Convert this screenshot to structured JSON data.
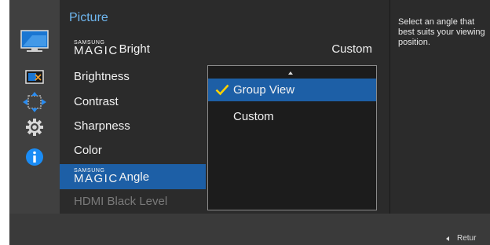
{
  "menu": {
    "title": "Picture",
    "magic_small": "SAMSUNG",
    "magic_big": "MAGIC",
    "items": [
      {
        "label": "Bright"
      },
      {
        "label": "Brightness"
      },
      {
        "label": "Contrast"
      },
      {
        "label": "Sharpness"
      },
      {
        "label": "Color"
      },
      {
        "label": "Angle"
      },
      {
        "label": "HDMI Black Level"
      }
    ],
    "current_value": "Custom"
  },
  "dropdown": {
    "options": [
      {
        "label": "Group View",
        "selected": true
      },
      {
        "label": "Custom",
        "selected": false
      }
    ]
  },
  "help": {
    "text": "Select an angle that best suits your viewing position."
  },
  "footer": {
    "return_label": "Retur"
  },
  "colors": {
    "accent": "#1d5fa6",
    "title": "#6fb7f0",
    "check": "#ffd200",
    "background": "#3a3a3a",
    "menu_bg": "#2b2b2b"
  },
  "sidebar": {
    "icons": [
      "picture-icon",
      "screen-display-icon",
      "position-arrows-icon",
      "gear-icon",
      "info-icon"
    ]
  }
}
